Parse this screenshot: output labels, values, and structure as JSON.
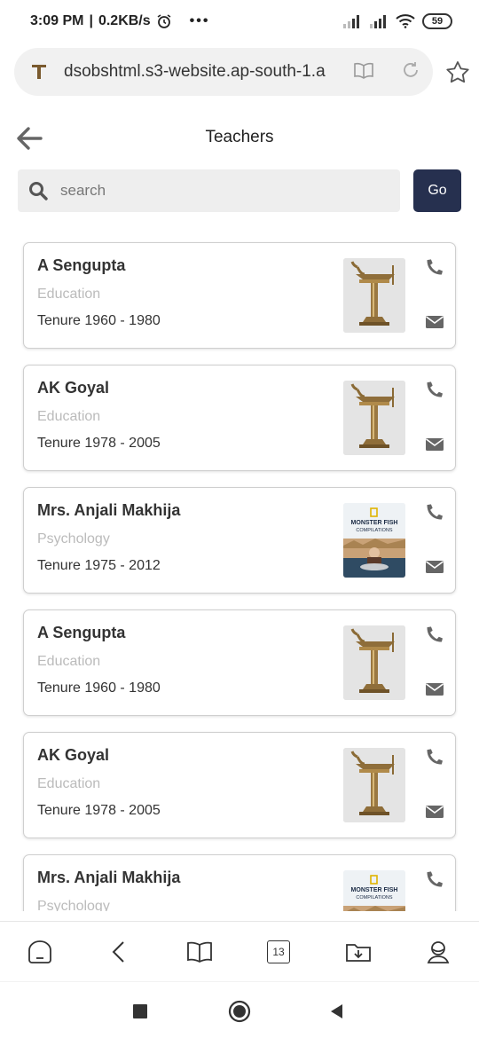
{
  "status_bar": {
    "time": "3:09 PM",
    "speed": "0.2KB/s",
    "battery": "59"
  },
  "browser": {
    "url": "dsobshtml.s3-website.ap-south-1.a",
    "tabs_count": "13"
  },
  "header": {
    "title": "Teachers"
  },
  "search": {
    "placeholder": "search",
    "value": "",
    "go_label": "Go"
  },
  "teachers": [
    {
      "name": "A Sengupta",
      "department": "Education",
      "tenure": "Tenure 1960 - 1980",
      "photo": "lamp-emblem"
    },
    {
      "name": "AK Goyal",
      "department": "Education",
      "tenure": "Tenure 1978 - 2005",
      "photo": "lamp-emblem"
    },
    {
      "name": "Mrs. Anjali Makhija",
      "department": "Psychology",
      "tenure": "Tenure 1975 - 2012",
      "photo": "monster-fish-thumbnail"
    },
    {
      "name": "A Sengupta",
      "department": "Education",
      "tenure": "Tenure 1960 - 1980",
      "photo": "lamp-emblem"
    },
    {
      "name": "AK Goyal",
      "department": "Education",
      "tenure": "Tenure 1978 - 2005",
      "photo": "lamp-emblem"
    },
    {
      "name": "Mrs. Anjali Makhija",
      "department": "Psychology",
      "tenure": "",
      "photo": "monster-fish-thumbnail"
    }
  ],
  "thumbnail_text": {
    "line1": "MONSTER FISH",
    "line2": "COMPILATIONS"
  },
  "colors": {
    "go_button": "#26304f",
    "icon_gray": "#666666",
    "department_text": "#bbbbbb"
  }
}
